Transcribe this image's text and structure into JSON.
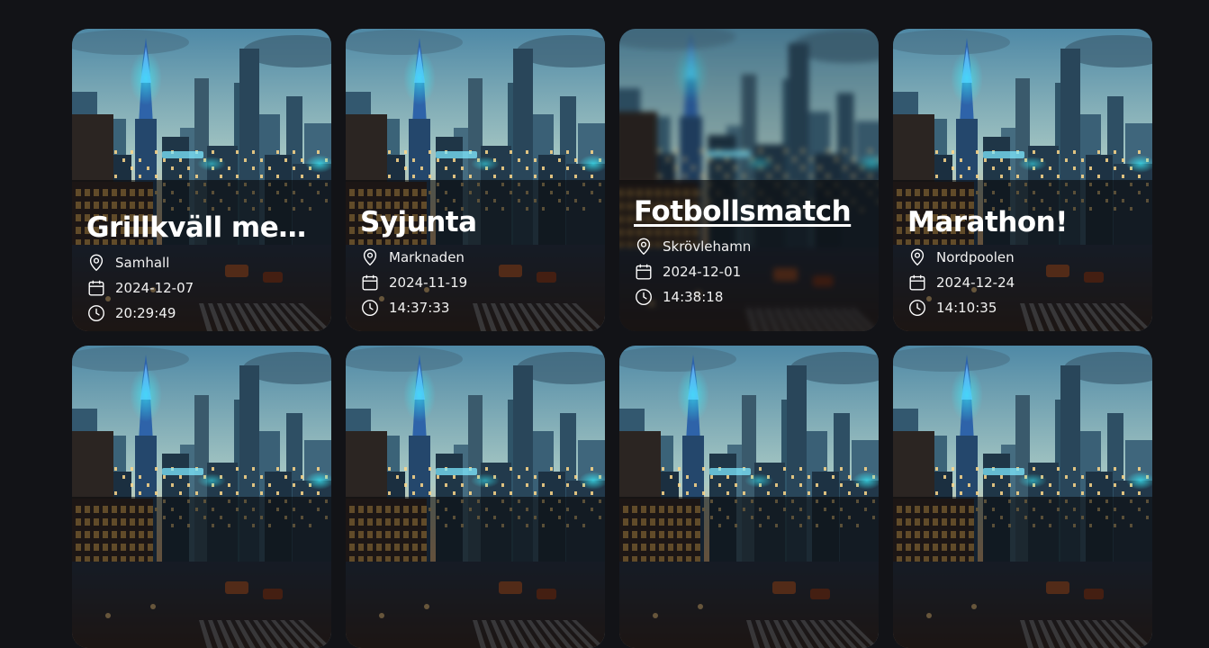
{
  "events": [
    {
      "title": "Grillkväll med G...",
      "location": "Samhall",
      "date": "2024-12-07",
      "time": "20:29:49"
    },
    {
      "title": "Syjunta",
      "location": "Marknaden",
      "date": "2024-11-19",
      "time": "14:37:33"
    },
    {
      "title": "Fotbollsmatch",
      "location": "Skrövlehamn",
      "date": "2024-12-01",
      "time": "14:38:18",
      "hovered": true
    },
    {
      "title": "Marathon!",
      "location": "Nordpoolen",
      "date": "2024-12-24",
      "time": "14:10:35"
    },
    {
      "title": "",
      "location": "",
      "date": "",
      "time": ""
    },
    {
      "title": "",
      "location": "",
      "date": "",
      "time": ""
    },
    {
      "title": "",
      "location": "",
      "date": "",
      "time": ""
    },
    {
      "title": "",
      "location": "",
      "date": "",
      "time": ""
    }
  ],
  "icons": {
    "location": "map-pin-icon",
    "date": "calendar-icon",
    "time": "clock-icon"
  }
}
